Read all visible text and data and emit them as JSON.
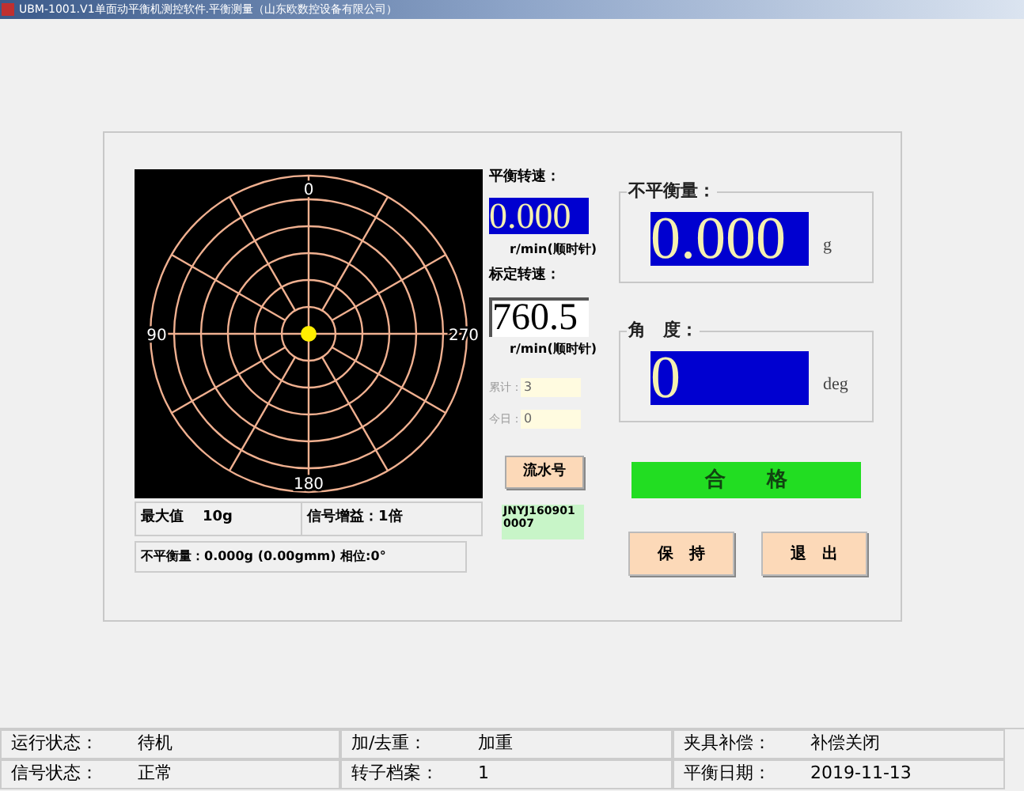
{
  "window": {
    "title": "UBM-1001.V1单面动平衡机测控软件.平衡测量（山东欧数控设备有限公司）"
  },
  "polar_display": {
    "labels": [
      {
        "text": "0",
        "kind": "top"
      },
      {
        "text": "90",
        "kind": "left"
      },
      {
        "text": "270",
        "kind": "right"
      },
      {
        "text": "180",
        "kind": "bottom"
      }
    ]
  },
  "info": {
    "max_label": "最大值",
    "max_value": "10g",
    "gain": "信号增益：1倍",
    "summary": "不平衡量：0.000g (0.00gmm) 相位:0°"
  },
  "balance_speed": {
    "label": "平衡转速：",
    "value": "0.000",
    "unit": "r/min(顺时针)"
  },
  "calib_speed": {
    "label": "标定转速：",
    "value": "760.5",
    "unit": "r/min(顺时针)"
  },
  "counters": [
    {
      "label": "累计：",
      "value": "3"
    },
    {
      "label": "今日：",
      "value": "0"
    }
  ],
  "serial_button": "流水号",
  "serial_value": "JNYJ1609010007",
  "unbalance": {
    "label": "不平衡量：",
    "value": "0.000",
    "unit": "g"
  },
  "angle": {
    "label": "角　度：",
    "value": "0",
    "unit": "deg"
  },
  "result": {
    "text": "合　　格",
    "pass": true
  },
  "buttons": [
    "保　持",
    "退　出"
  ],
  "status_bar": [
    {
      "label": "运行状态：",
      "value": "待机"
    },
    {
      "label": "加/去重：",
      "value": "加重"
    },
    {
      "label": "夹具补偿：",
      "value": "补偿关闭"
    },
    {
      "label": "信号状态：",
      "value": "正常"
    },
    {
      "label": "转子档案：",
      "value": "1"
    },
    {
      "label": "平衡日期：",
      "value": "2019-11-13"
    }
  ]
}
